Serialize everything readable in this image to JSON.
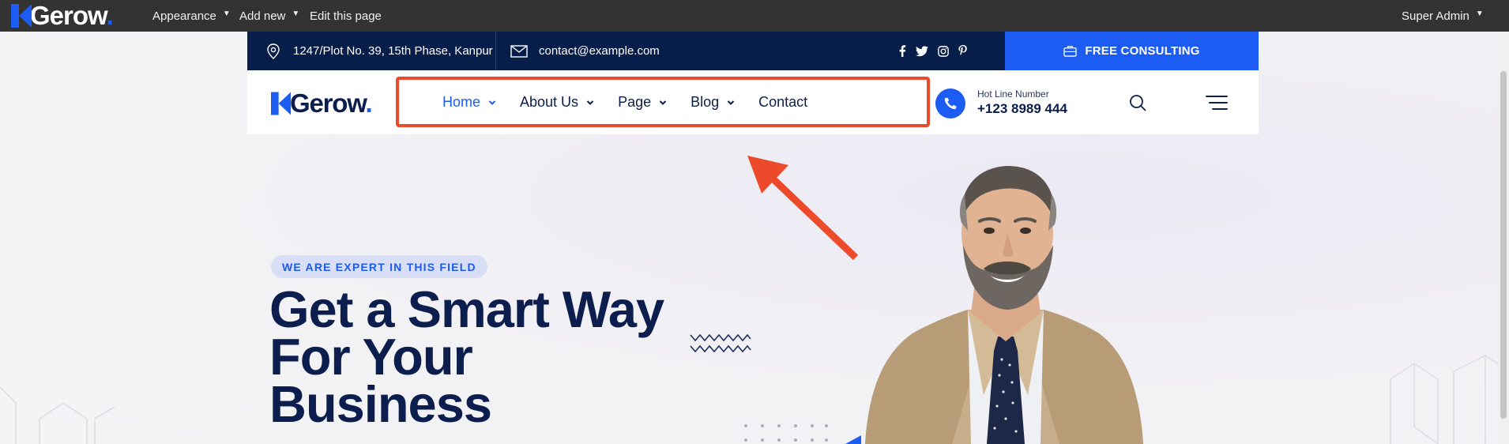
{
  "admin_bar": {
    "logo_text": "Gerow",
    "logo_dot": ".",
    "menu": {
      "appearance": "Appearance",
      "add_new": "Add new",
      "edit_page": "Edit this page"
    },
    "user": "Super Admin"
  },
  "topbar": {
    "address": "1247/Plot No. 39, 15th Phase, Kanpur",
    "email": "contact@example.com",
    "social_icons": [
      "facebook-icon",
      "twitter-icon",
      "instagram-icon",
      "pinterest-icon"
    ],
    "cta_label": "FREE CONSULTING"
  },
  "nav": {
    "logo_text": "Gerow",
    "logo_dot": ".",
    "items": [
      {
        "label": "Home",
        "has_dropdown": true,
        "active": true
      },
      {
        "label": "About Us",
        "has_dropdown": true
      },
      {
        "label": "Page",
        "has_dropdown": true
      },
      {
        "label": "Blog",
        "has_dropdown": true
      },
      {
        "label": "Contact",
        "has_dropdown": false
      }
    ],
    "hotline_label": "Hot Line Number",
    "hotline_number": "+123 8989 444"
  },
  "hero": {
    "badge": "WE ARE EXPERT IN THIS FIELD",
    "title_line1": "Get a Smart Way",
    "title_line2": "For Your",
    "title_line3": "Business"
  },
  "colors": {
    "brand_blue": "#1c5cf2",
    "navy": "#0b1e4d",
    "topbar_bg": "#071d4a",
    "highlight_red": "#ec4a2b"
  }
}
